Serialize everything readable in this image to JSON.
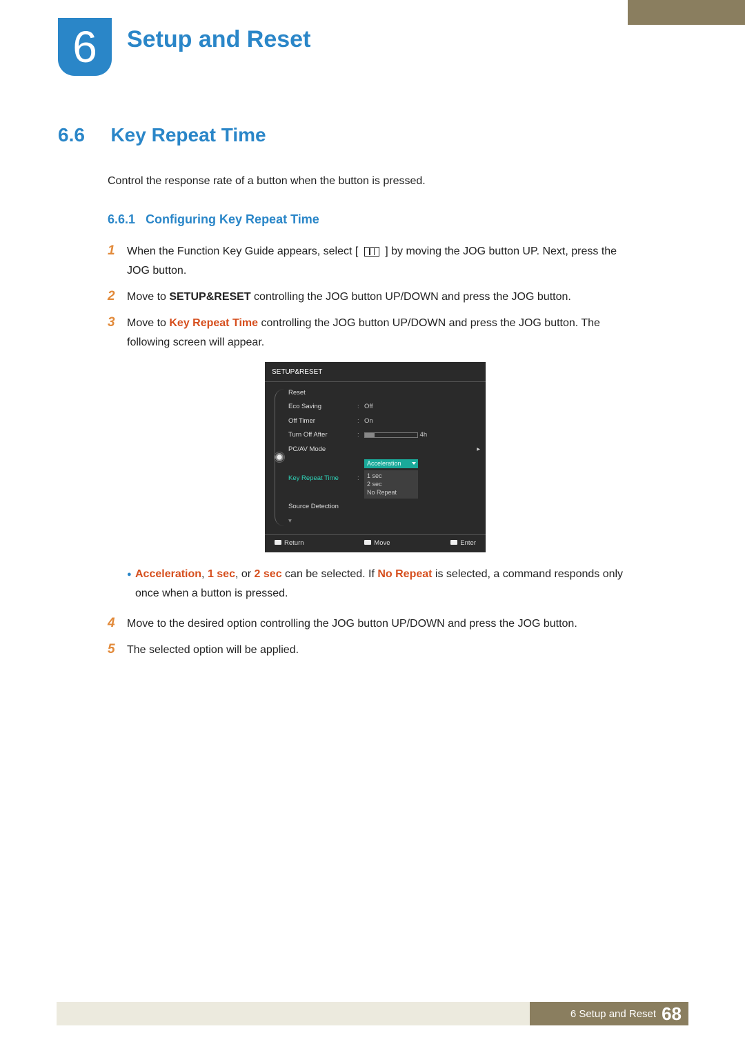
{
  "chapter": {
    "number": "6",
    "title": "Setup and Reset"
  },
  "section": {
    "number": "6.6",
    "title": "Key Repeat Time"
  },
  "description": "Control the response rate of a button when the button is pressed.",
  "subsection": {
    "number": "6.6.1",
    "title": "Configuring Key Repeat Time"
  },
  "steps": {
    "s1_num": "1",
    "s1_before_icon": "When the Function Key Guide appears, select [",
    "s1_after_icon": "] by moving the JOG button UP. Next, press the JOG button.",
    "s2_num": "2",
    "s2_a": "Move to ",
    "s2_b": "SETUP&RESET",
    "s2_c": " controlling the JOG button UP/DOWN and press the JOG button.",
    "s3_num": "3",
    "s3_a": "Move to ",
    "s3_b": "Key Repeat Time",
    "s3_c": " controlling the JOG button UP/DOWN and press the JOG button. The following screen will appear.",
    "s4_num": "4",
    "s4": "Move to the desired option controlling the JOG button UP/DOWN and press the JOG button.",
    "s5_num": "5",
    "s5": "The selected option will be applied."
  },
  "note": {
    "acc": "Acceleration",
    "sep1": ", ",
    "one": "1 sec",
    "mid": ", or ",
    "two": "2 sec",
    "after1": " can be selected. If ",
    "norep": "No Repeat",
    "after2": " is selected, a command responds only once when a button is pressed."
  },
  "osd": {
    "title": "SETUP&RESET",
    "rows": {
      "reset": "Reset",
      "eco": "Eco Saving",
      "eco_val": "Off",
      "offtimer": "Off Timer",
      "offtimer_val": "On",
      "turnoff": "Turn Off After",
      "turnoff_val": "4h",
      "pcav": "PC/AV Mode",
      "krt": "Key Repeat Time",
      "krt_val": "Acceleration",
      "opt1": "1 sec",
      "opt2": "2 sec",
      "opt3": "No Repeat",
      "srcdet": "Source Detection"
    },
    "footer": {
      "return": "Return",
      "move": "Move",
      "enter": "Enter"
    }
  },
  "footer": {
    "label": "6 Setup and Reset",
    "page": "68"
  }
}
